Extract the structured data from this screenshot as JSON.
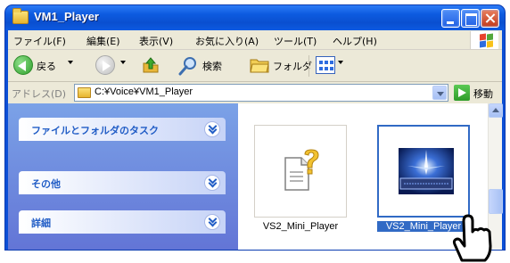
{
  "window": {
    "title": "VM1_Player",
    "colors": {
      "titlebar": "#0a4fd0",
      "taskpane": "#7ba2e7",
      "selection": "#316ac5"
    }
  },
  "menu": {
    "items": [
      "ファイル(F)",
      "編集(E)",
      "表示(V)",
      "お気に入り(A)",
      "ツール(T)",
      "ヘルプ(H)"
    ]
  },
  "toolbar": {
    "back_label": "戻る",
    "search_label": "検索",
    "folders_label": "フォルダ",
    "icons": [
      "back-icon",
      "forward-icon",
      "up-folder-icon",
      "search-icon",
      "folders-icon",
      "views-icon"
    ]
  },
  "address": {
    "label": "アドレス(D)",
    "value": "C:¥Voice¥VM1_Player",
    "go_label": "移動"
  },
  "taskpane": {
    "groups": [
      {
        "label": "ファイルとフォルダのタスク"
      },
      {
        "label": "その他"
      },
      {
        "label": "詳細"
      }
    ]
  },
  "files": [
    {
      "name": "VS2_Mini_Player",
      "icon": "unknown-file-icon",
      "selected": false
    },
    {
      "name": "VS2_Mini_Player",
      "icon": "app-thumbnail-icon",
      "selected": true
    }
  ]
}
